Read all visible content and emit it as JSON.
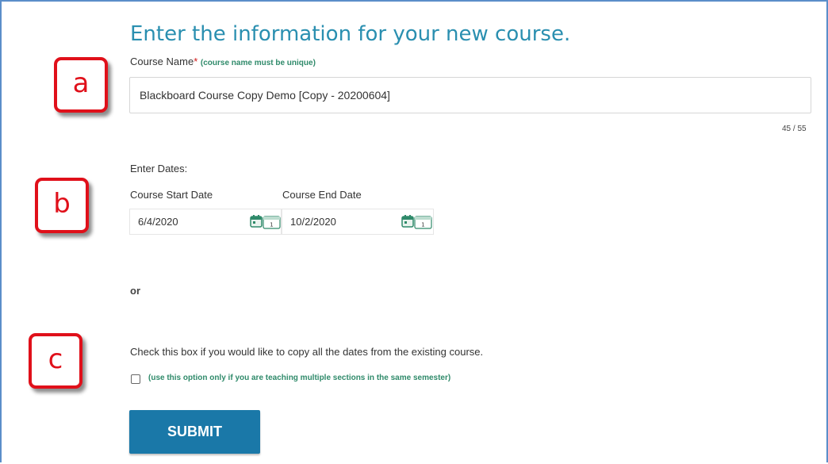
{
  "title": "Enter the information for your new course.",
  "course_name": {
    "label": "Course Name",
    "required_mark": "*",
    "hint": "(course name must be unique)",
    "value": "Blackboard Course Copy Demo [Copy - 20200604]",
    "counter": "45 / 55"
  },
  "dates": {
    "heading": "Enter Dates:",
    "start_label": "Course Start Date",
    "start_value": "6/4/2020",
    "end_label": "Course End Date",
    "end_value": "10/2/2020",
    "icon": "calendar-icon"
  },
  "or_text": "or",
  "copy_dates": {
    "text": "Check this box if you would like to copy all the dates from the existing course.",
    "hint": "(use this option only if you are teaching multiple sections in the same semester)",
    "checked": false
  },
  "submit_label": "SUBMIT",
  "callouts": [
    "a",
    "b",
    "c"
  ],
  "colors": {
    "title": "#2a8fb0",
    "hint": "#2f8a6a",
    "submit": "#1a78a8",
    "callout": "#e0101a",
    "frame": "#5b8ec9"
  }
}
